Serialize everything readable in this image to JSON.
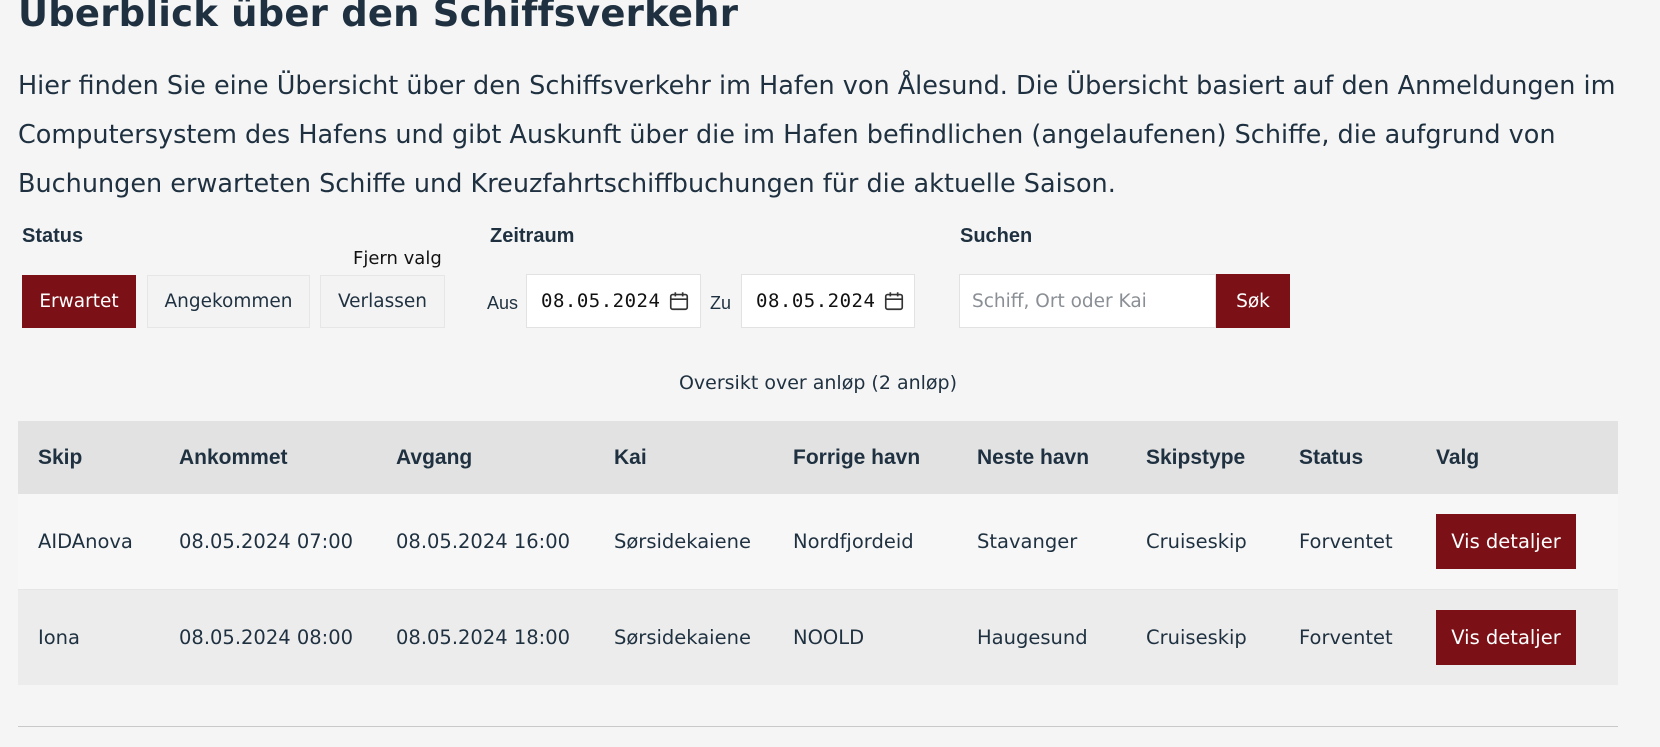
{
  "header": {
    "title": "Überblick über den Schiffsverkehr",
    "intro": "Hier finden Sie eine Übersicht über den Schiffsverkehr im Hafen von Ålesund. Die Übersicht basiert auf den Anmeldungen im Computersystem des Hafens und gibt Auskunft über die im Hafen befindlichen (angelaufenen) Schiffe, die aufgrund von Buchungen erwarteten Schiffe und Kreuzfahrtschiffbuchungen für die aktuelle Saison."
  },
  "filters": {
    "status_label": "Status",
    "clear_label": "Fjern valg",
    "status_options": [
      "Erwartet",
      "Angekommen",
      "Verlassen"
    ],
    "status_selected": "Erwartet",
    "period_label": "Zeitraum",
    "from_label": "Aus",
    "from_value": "08.05.2024",
    "to_label": "Zu",
    "to_value": "08.05.2024",
    "search_label": "Suchen",
    "search_placeholder": "Schiff, Ort oder Kai",
    "search_button": "Søk"
  },
  "table": {
    "caption": "Oversikt over anløp (2 anløp)",
    "headers": [
      "Skip",
      "Ankommet",
      "Avgang",
      "Kai",
      "Forrige havn",
      "Neste havn",
      "Skipstype",
      "Status",
      "Valg"
    ],
    "rows": [
      {
        "ship": "AIDAnova",
        "arrived": "08.05.2024 07:00",
        "departure": "08.05.2024 16:00",
        "quay": "Sørsidekaiene",
        "previous_port": "Nordfjordeid",
        "next_port": "Stavanger",
        "ship_type": "Cruiseskip",
        "status": "Forventet",
        "action": "Vis detaljer"
      },
      {
        "ship": "Iona",
        "arrived": "08.05.2024 08:00",
        "departure": "08.05.2024 18:00",
        "quay": "Sørsidekaiene",
        "previous_port": "NOOLD",
        "next_port": "Haugesund",
        "ship_type": "Cruiseskip",
        "status": "Forventet",
        "action": "Vis detaljer"
      }
    ]
  },
  "colors": {
    "accent": "#7b1116",
    "text": "#1f3140",
    "background": "#f5f5f5",
    "table_header": "#e2e2e2"
  },
  "icons": {
    "date_picker": "calendar-icon"
  }
}
